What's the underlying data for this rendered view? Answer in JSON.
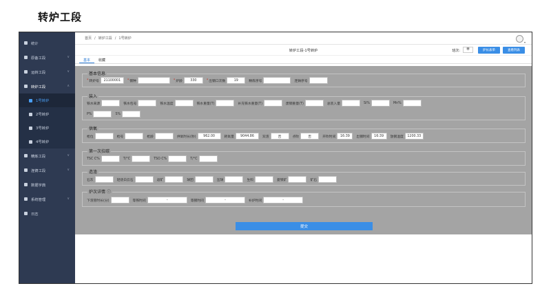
{
  "page_title": "转炉工段",
  "sidebar": {
    "items": [
      {
        "label": "统计"
      },
      {
        "label": "原备工段"
      },
      {
        "label": "运转工段"
      },
      {
        "label": "转炉工段"
      },
      {
        "label": "精炼工段"
      },
      {
        "label": "连铸工段"
      },
      {
        "label": "数据字典"
      },
      {
        "label": "系统管理"
      },
      {
        "label": "日志"
      }
    ],
    "subitems": [
      {
        "label": "1号转炉"
      },
      {
        "label": "2号转炉"
      },
      {
        "label": "3号转炉"
      },
      {
        "label": "4号转炉"
      }
    ]
  },
  "breadcrumb": {
    "home": "首页",
    "sep": "/",
    "section": "转炉工段",
    "current": "1号转炉"
  },
  "header": {
    "center_title": "转炉工段-1号转炉",
    "sort_label": "班次:",
    "sort_value": "甲",
    "btn_furnace": "炉长表单",
    "btn_list": "查看列表"
  },
  "tabs": [
    {
      "label": "基本"
    },
    {
      "label": "收藏"
    }
  ],
  "basic_info": {
    "title": "基本信息",
    "converter_no_label": "转炉号",
    "converter_no_value": "21100001",
    "steel_grade_label": "钢种",
    "furnace_age_label": "炉龄",
    "furnace_age_value": "330",
    "tap_times_label": "出钢口次数",
    "tap_times_value": "19",
    "refine_seq_label": "精炼序号",
    "cast_seq_label": "连铸序号"
  },
  "charge": {
    "title": "装入",
    "iron_source_label": "铁水来源",
    "iron_ladle_label": "铁水包号",
    "iron_temp_label": "铁水温度",
    "iron_weight_label": "铁水重量(T)",
    "extra_iron_label": "补充铁水重量(T)",
    "scrap_weight_label": "废钢重量(T)",
    "total_charge_label": "总装入量",
    "si_label": "Si%",
    "mn_label": "Mn%",
    "p_label": "P%",
    "s_label": "S%"
  },
  "oxygen": {
    "title": "供氧",
    "gun_pos_label": "枪位",
    "gun_no_label": "枪号",
    "gun_age_label": "枪龄",
    "supply_time_label": "供氧时长(秒)",
    "supply_time_value": "962.00",
    "oxygen_volume_label": "耗氧量",
    "oxygen_volume_value": "9044.86",
    "double_slag_label": "双渣",
    "double_slag_value": "否",
    "reblow_label": "点吹",
    "reblow_value": "否",
    "start_time_label": "开吹时间",
    "start_time_value": "16:39",
    "tap_time_label": "出钢时间",
    "tap_time_value": "16:39",
    "tap_temp_label": "放钢温度",
    "tap_temp_value": "1200.33"
  },
  "first_sample": {
    "title": "第一次拉碳",
    "tsc_label": "TSC C%",
    "tc_label": "T/°C",
    "tso_label": "TSO C%",
    "tc2_label": "T/°C"
  },
  "slag": {
    "title": "造渣",
    "lime_label": "石灰",
    "dolomite_label": "轻烧白云石",
    "ore_label": "返矿",
    "pellet_label": "球团",
    "pressed_label": "压球",
    "raw_label": "生料",
    "iron_ore_label": "菱铁矿",
    "ore2_label": "矿石"
  },
  "detail": {
    "title": "炉次详情",
    "down_time_label": "下渣管时长(分)",
    "wait_iron_label": "等铁时间",
    "wait_iron_value": "-",
    "wait_steel_label": "等钢时间",
    "wait_steel_value": "-",
    "repair_label": "补炉时间",
    "repair_value": "-"
  },
  "submit_label": "提交"
}
